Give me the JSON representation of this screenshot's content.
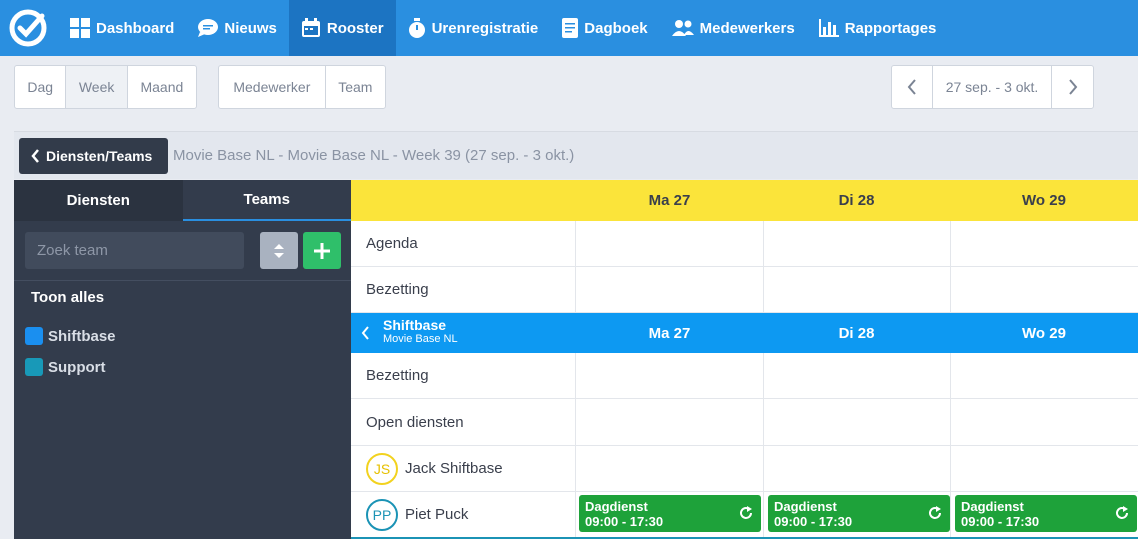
{
  "nav": {
    "items": [
      {
        "label": "Dashboard",
        "icon": "dashboard-icon",
        "active": false
      },
      {
        "label": "Nieuws",
        "icon": "chat-icon",
        "active": false
      },
      {
        "label": "Rooster",
        "icon": "calendar-icon",
        "active": true
      },
      {
        "label": "Urenregistratie",
        "icon": "stopwatch-icon",
        "active": false
      },
      {
        "label": "Dagboek",
        "icon": "document-icon",
        "active": false
      },
      {
        "label": "Medewerkers",
        "icon": "users-icon",
        "active": false
      },
      {
        "label": "Rapportages",
        "icon": "bar-chart-icon",
        "active": false
      }
    ]
  },
  "toolbar": {
    "period": [
      "Dag",
      "Week",
      "Maand"
    ],
    "period_active": "Week",
    "view": [
      "Medewerker",
      "Team"
    ],
    "date_range": "27 sep. - 3 okt."
  },
  "header": {
    "back_label": "Diensten/Teams",
    "title": "Movie Base NL - Movie Base NL - Week 39 (27 sep. - 3 okt.)"
  },
  "sidebar": {
    "tabs": [
      "Diensten",
      "Teams"
    ],
    "active_tab": "Teams",
    "search_placeholder": "Zoek team",
    "show_all": "Toon alles",
    "teams": [
      {
        "name": "Shiftbase",
        "color": "#1a8ff0"
      },
      {
        "name": "Support",
        "color": "#1899b8"
      }
    ]
  },
  "schedule": {
    "days": [
      "Ma 27",
      "Di 28",
      "Wo 29"
    ],
    "top_rows": [
      "Agenda",
      "Bezetting"
    ],
    "team": {
      "name": "Shiftbase",
      "sub": "Movie Base NL"
    },
    "team_rows": [
      "Bezetting",
      "Open diensten"
    ],
    "employees": [
      {
        "initials": "JS",
        "name": "Jack Shiftbase",
        "color": "#f2d21f"
      },
      {
        "initials": "PP",
        "name": "Piet Puck",
        "color": "#1b93b5"
      }
    ],
    "shifts": [
      {
        "name": "Dagdienst",
        "time": "09:00 - 17:30"
      },
      {
        "name": "Dagdienst",
        "time": "09:00 - 17:30"
      },
      {
        "name": "Dagdienst",
        "time": "09:00 - 17:30"
      }
    ]
  },
  "colors": {
    "nav_bg": "#2a8fe0",
    "day_header": "#fbe43a",
    "team_bar": "#0d99f2",
    "shift_green": "#1ea23a"
  }
}
